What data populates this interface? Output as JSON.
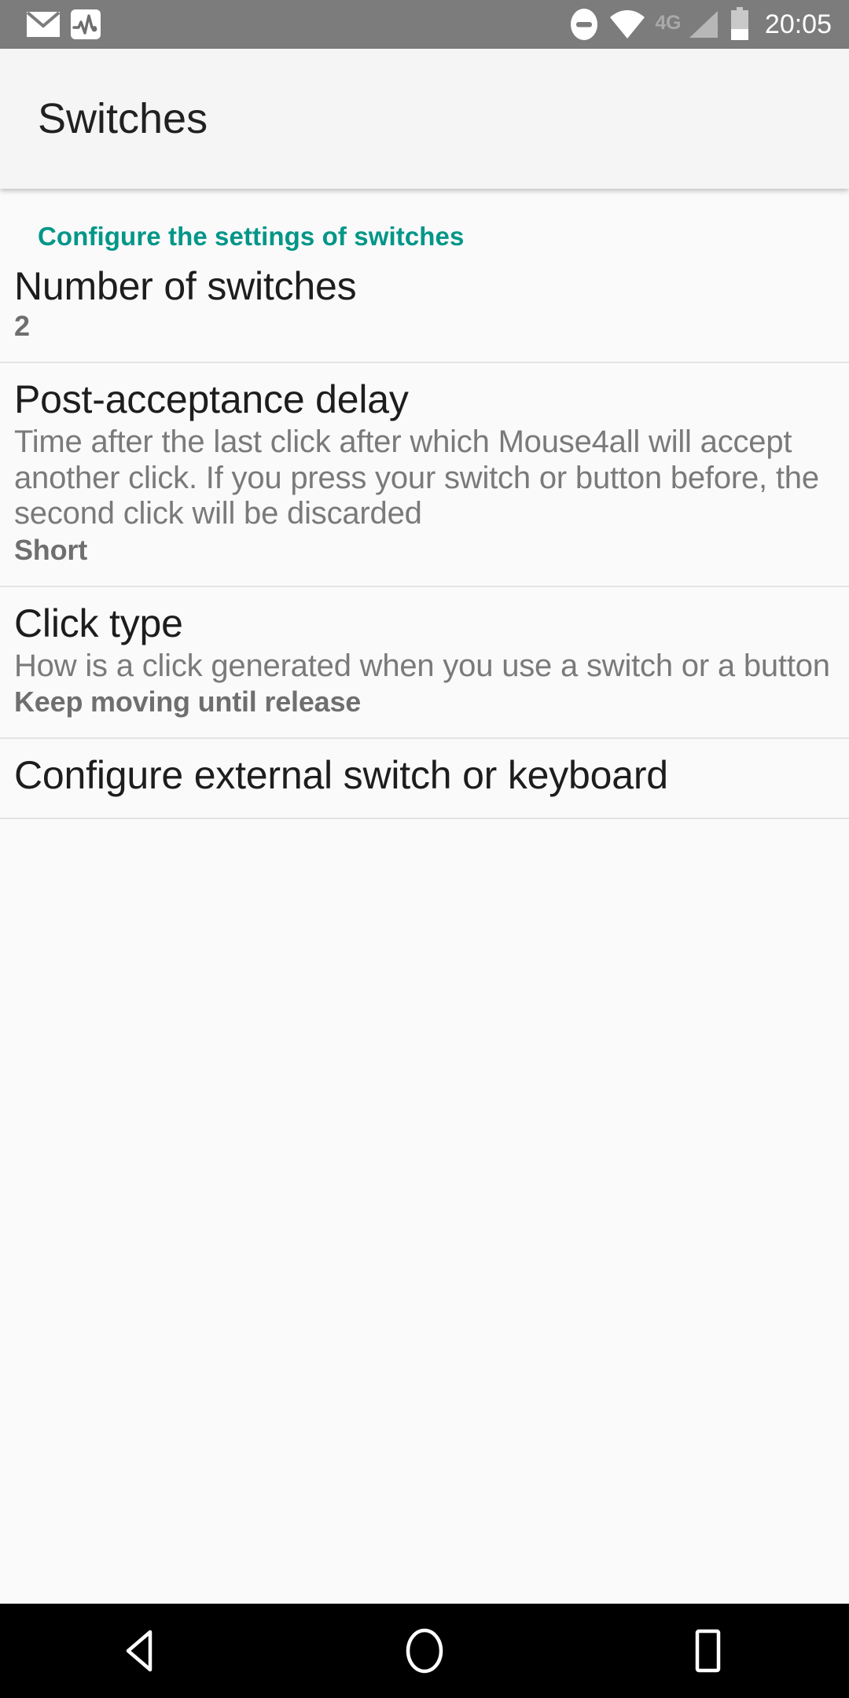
{
  "status_bar": {
    "background": "#7c7c7c",
    "left_icons": [
      {
        "name": "email-icon",
        "label": "Unread email"
      },
      {
        "name": "heart-rate-icon",
        "label": "Activity monitor"
      }
    ],
    "right_icons": [
      {
        "name": "do-not-disturb-icon",
        "label": "Do not disturb"
      },
      {
        "name": "wifi-icon",
        "label": "Wi-Fi"
      },
      {
        "name": "mobile-network-label",
        "label": "4G"
      },
      {
        "name": "cellular-signal-icon",
        "label": "Signal"
      },
      {
        "name": "battery-icon",
        "label": "Battery"
      }
    ],
    "network_label": "4G",
    "time": "20:05"
  },
  "app_bar": {
    "title": "Switches",
    "background": "#f5f5f5"
  },
  "category": {
    "label": "Configure the settings of switches",
    "color": "#009688"
  },
  "preferences": [
    {
      "key": "number_of_switches",
      "title": "Number of switches",
      "summary": "",
      "value": "2"
    },
    {
      "key": "post_acceptance_delay",
      "title": "Post-acceptance delay",
      "summary": "Time after the last click after which Mouse4all will accept another click. If you press your switch or button before, the second click will be discarded",
      "value": "Short"
    },
    {
      "key": "click_type",
      "title": "Click type",
      "summary": "How is a click generated when you use a switch or a button",
      "value": "Keep moving until release"
    },
    {
      "key": "configure_external",
      "title": "Configure external switch or keyboard",
      "summary": "",
      "value": ""
    }
  ],
  "nav_bar": {
    "background": "#000000",
    "buttons": [
      {
        "name": "back-button",
        "label": "Back"
      },
      {
        "name": "home-button",
        "label": "Home"
      },
      {
        "name": "recents-button",
        "label": "Recents"
      }
    ]
  }
}
